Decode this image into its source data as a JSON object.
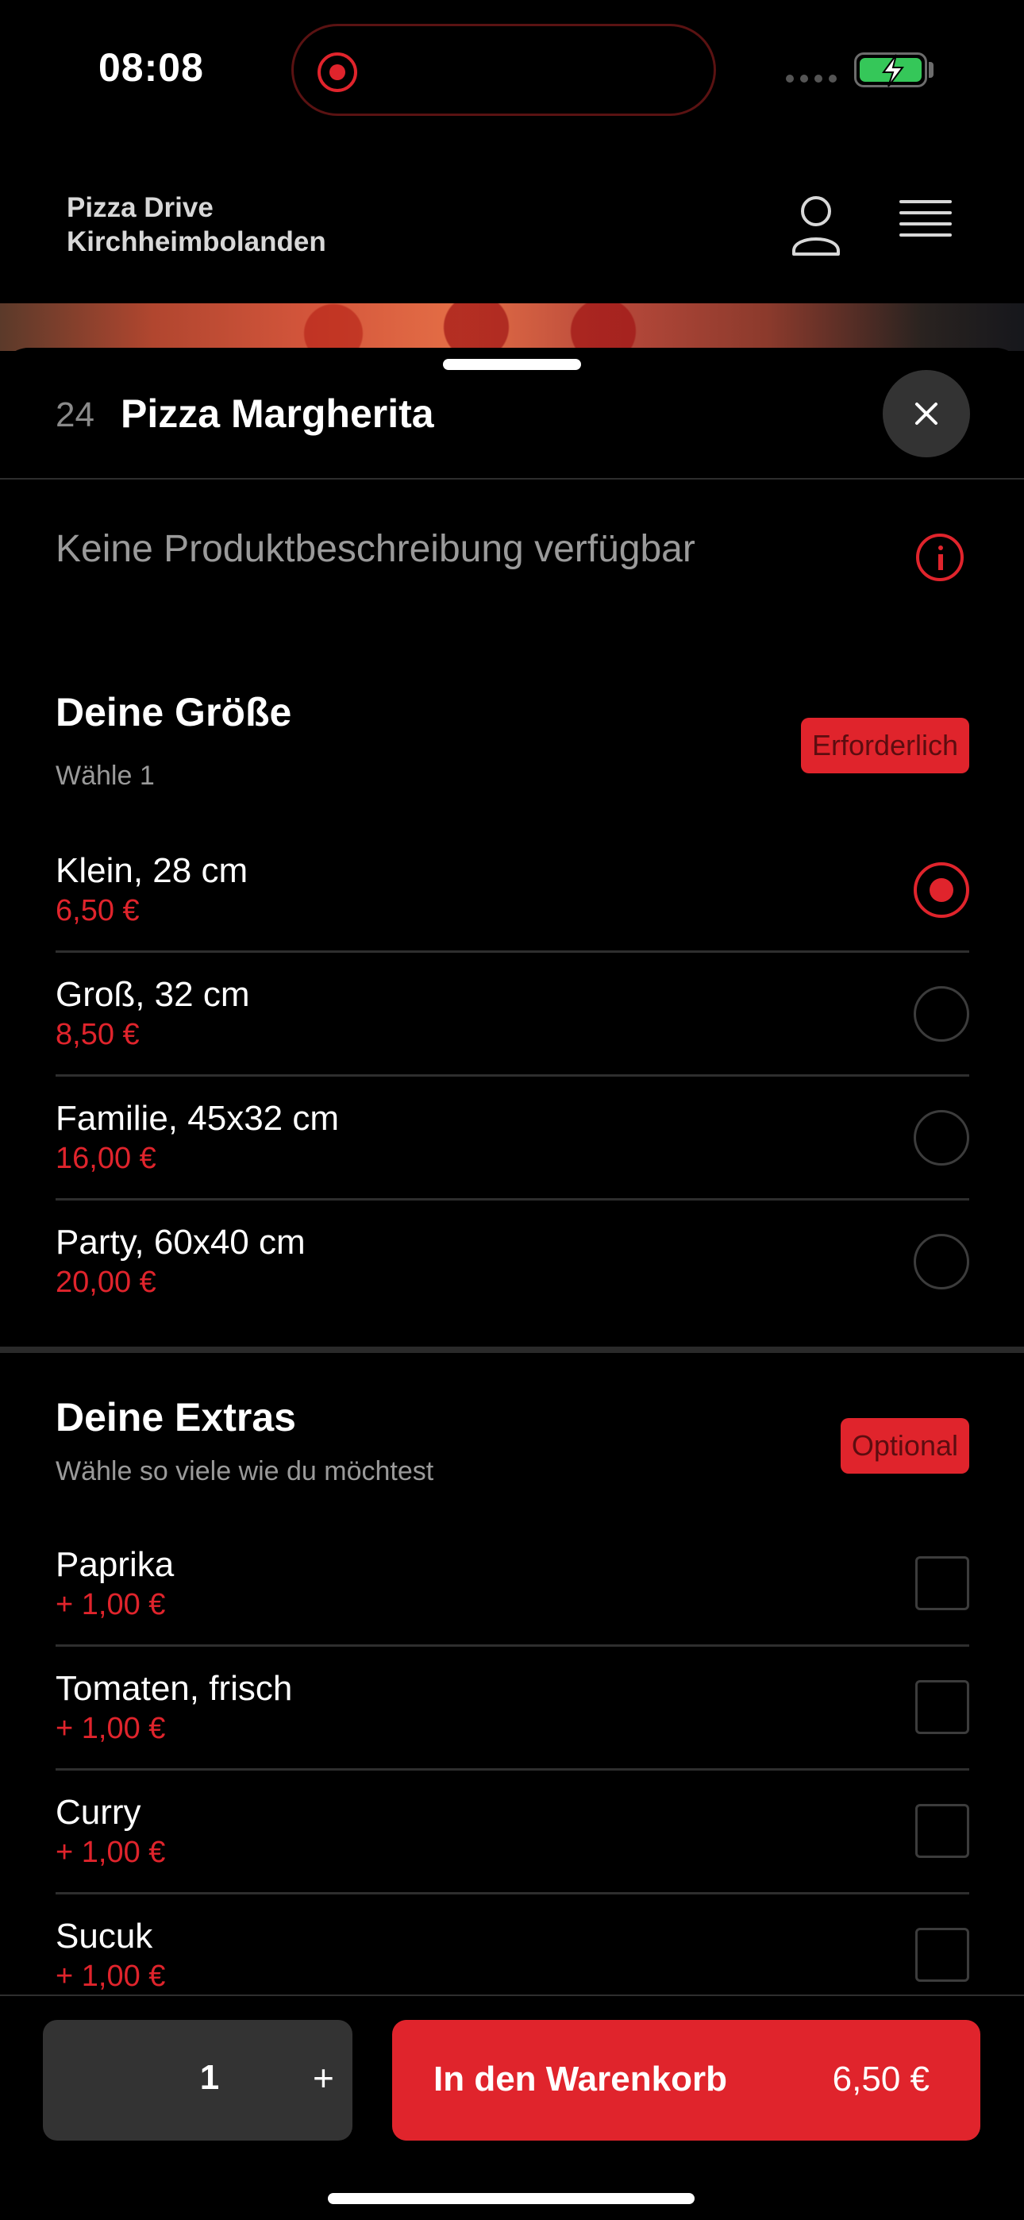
{
  "status_bar": {
    "time": "08:08"
  },
  "header": {
    "brand_line1": "Pizza Drive",
    "brand_line2": "Kirchheimbolanden",
    "profile_icon": "person-icon",
    "menu_icon": "hamburger-menu-icon"
  },
  "product": {
    "number": "24",
    "title": "Pizza Margherita",
    "description": "Keine Produktbeschreibung verfügbar"
  },
  "size_group": {
    "title": "Deine Größe",
    "subtitle": "Wähle 1",
    "badge": "Erforderlich",
    "options": [
      {
        "name": "Klein, 28 cm",
        "price": "6,50 €",
        "selected": true
      },
      {
        "name": "Groß, 32 cm",
        "price": "8,50 €",
        "selected": false
      },
      {
        "name": "Familie, 45x32 cm",
        "price": "16,00 €",
        "selected": false
      },
      {
        "name": "Party, 60x40 cm",
        "price": "20,00 €",
        "selected": false
      }
    ]
  },
  "extras_group": {
    "title": "Deine Extras",
    "subtitle": "Wähle so viele wie du möchtest",
    "badge": "Optional",
    "options": [
      {
        "name": "Paprika",
        "price": "+ 1,00 €",
        "checked": false
      },
      {
        "name": "Tomaten, frisch",
        "price": "+ 1,00 €",
        "checked": false
      },
      {
        "name": "Curry",
        "price": "+ 1,00 €",
        "checked": false
      },
      {
        "name": "Sucuk",
        "price": "+ 1,00 €",
        "checked": false
      }
    ]
  },
  "bottom_bar": {
    "quantity": "1",
    "plus_label": "+",
    "cart_label": "In den Warenkorb",
    "cart_price": "6,50 €"
  },
  "colors": {
    "accent": "#e0242c",
    "background": "#000000",
    "surface": "#333333"
  }
}
